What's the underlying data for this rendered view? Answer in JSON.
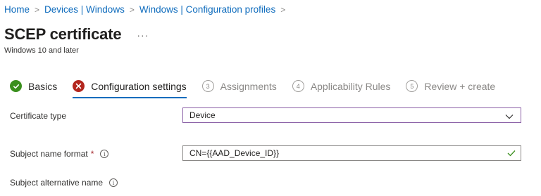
{
  "breadcrumb": {
    "items": [
      "Home",
      "Devices | Windows",
      "Windows | Configuration profiles"
    ]
  },
  "header": {
    "title": "SCEP certificate",
    "more_label": "···",
    "subtitle": "Windows 10 and later"
  },
  "wizard": {
    "steps": [
      {
        "label": "Basics",
        "state": "done",
        "icon": "check-circle-icon"
      },
      {
        "label": "Configuration settings",
        "state": "error",
        "icon": "error-circle-icon"
      },
      {
        "label": "Assignments",
        "state": "pending",
        "number": "3"
      },
      {
        "label": "Applicability Rules",
        "state": "pending",
        "number": "4"
      },
      {
        "label": "Review + create",
        "state": "pending",
        "number": "5"
      }
    ]
  },
  "form": {
    "certificate_type": {
      "label": "Certificate type",
      "value": "Device"
    },
    "subject_name_format": {
      "label": "Subject name format",
      "required_mark": "*",
      "value": "CN={{AAD_Device_ID}}"
    },
    "subject_alternative_name": {
      "label": "Subject alternative name"
    },
    "info_glyph": "i"
  },
  "colors": {
    "accent": "#0f6cbd",
    "success": "#3a8f1d",
    "error": "#b3261e",
    "select_border": "#8a5fa6"
  }
}
